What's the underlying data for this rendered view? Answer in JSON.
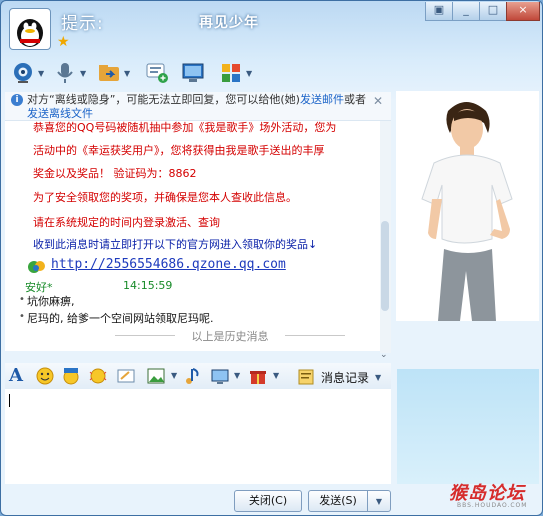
{
  "header": {
    "hint": "提示:",
    "title": "再见少年"
  },
  "window_controls": [
    "▣",
    "_",
    "□",
    "×"
  ],
  "toolbar_icons": [
    "camera-icon",
    "microphone-icon",
    "file-transfer-icon",
    "sms-icon",
    "remote-desktop-icon",
    "apps-icon"
  ],
  "notice": {
    "text_a": "对方“离线或隐身”，可能无法立即回复，您可以给他(她)",
    "link_a": "发送邮件",
    "text_b": "或者",
    "link_b": "发送离线文件"
  },
  "chat": {
    "lines_red": [
      "  恭喜您的QQ号码被随机抽中参加《我是歌手》场外活动，您为",
      "活动中的《幸运获奖用户》，您将获得由我是歌手送出的丰厚",
      "奖金以及奖品！  验证码为：8862",
      "为了安全领取您的奖项，并确保是您本人查收此信息。",
      "请在系统规定的时间内登录激活、查询"
    ],
    "line_blue": "收到此消息时请立即打开以下的官方网进入领取你的奖品↓",
    "url": "http://2556554686.qzone.qq.com",
    "sender": "安好*",
    "time": "14:15:59",
    "msg1": "坑你麻痹,",
    "msg2": "尼玛的, 给爹一个空间网站领取尼玛呢.",
    "history": "以上是历史消息"
  },
  "input_toolbar": {
    "history_label": "消息记录"
  },
  "buttons": {
    "close": "关闭(C)",
    "send": "发送(S)"
  },
  "watermark": {
    "text": "猴岛论坛",
    "sub": "BBS.HOUDAO.COM"
  }
}
